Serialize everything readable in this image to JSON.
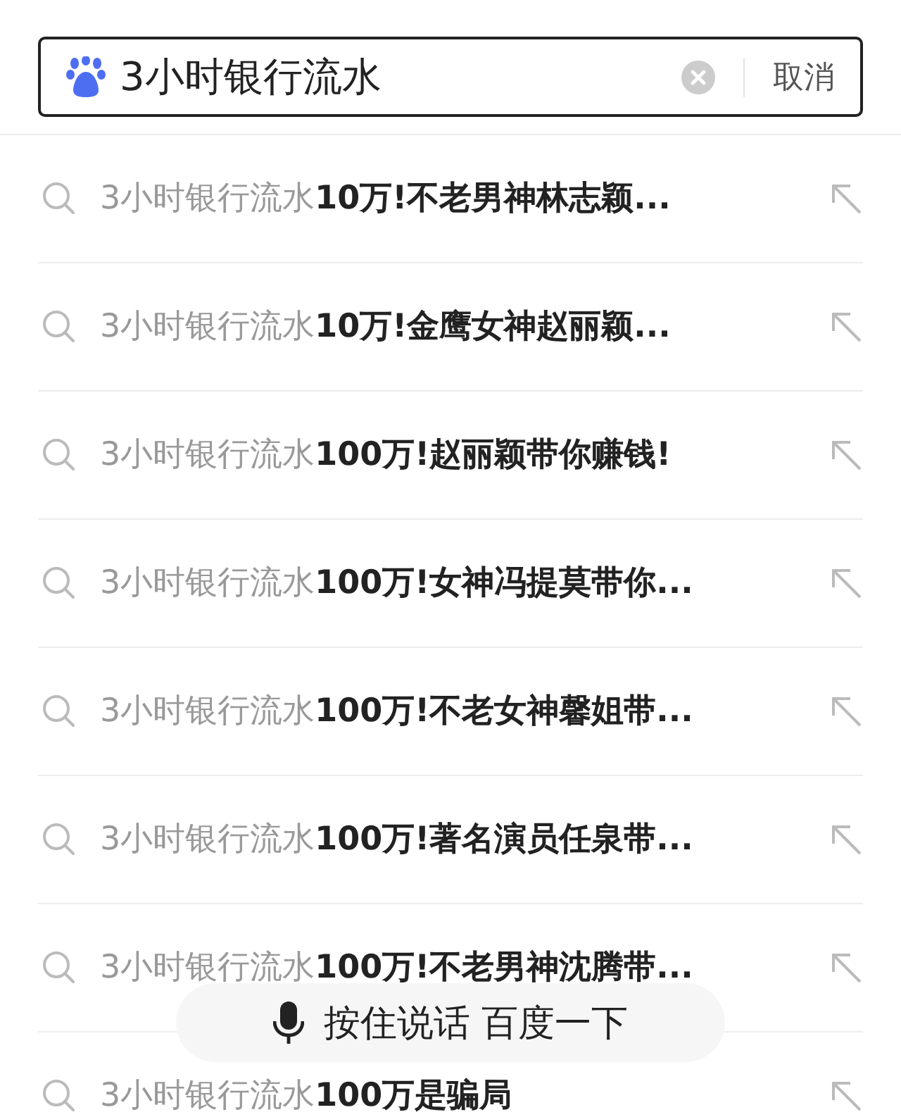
{
  "search": {
    "value": "3小时银行流水",
    "cancel": "取消"
  },
  "suggestions": [
    {
      "text": "3小时银行流水**10万!不老男神林志颖...**"
    },
    {
      "text": "3小时银行流水**10万!金鹰女神赵丽颖...**"
    },
    {
      "text": "3小时银行流水**100万!赵丽颖带你赚钱!**"
    },
    {
      "text": "3小时银行流水**100万!女神冯提莫带你...**"
    },
    {
      "text": "3小时银行流水**100万!不老女神馨姐带...**"
    },
    {
      "text": "3小时银行流水**100万!著名演员任泉带...**"
    },
    {
      "text": "3小时银行流水**100万!不老男神沈腾带...**"
    },
    {
      "text": "3小时银行流水**100万是骗局**"
    }
  ],
  "voice_button": "按住说话 百度一下"
}
